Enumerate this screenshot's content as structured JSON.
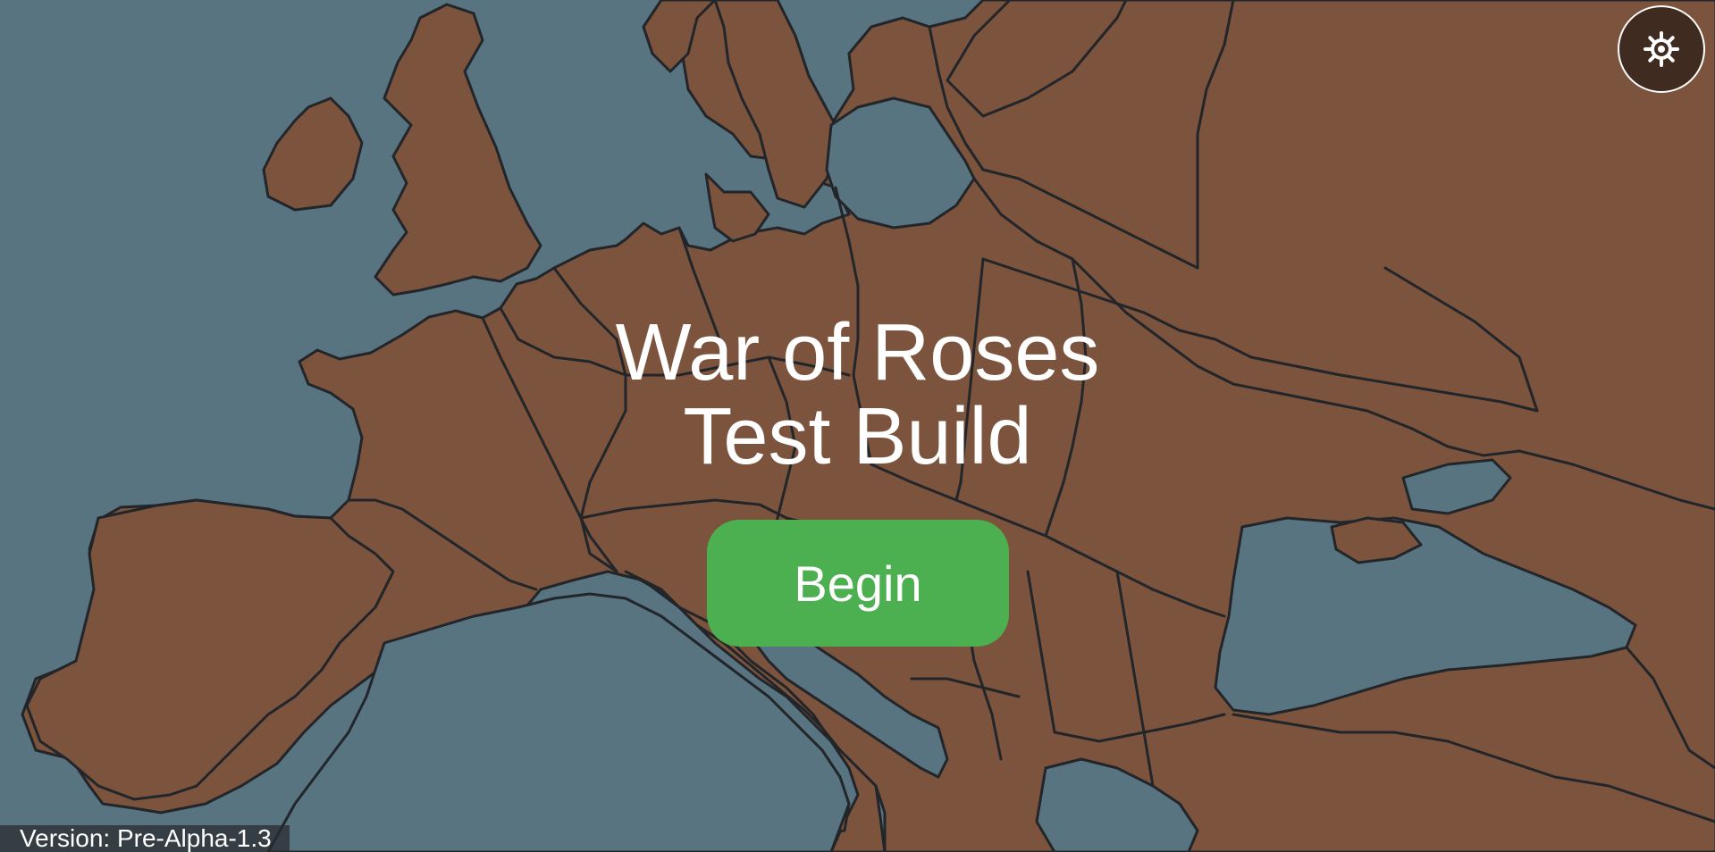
{
  "title": {
    "line1": "War of Roses",
    "line2": "Test Build"
  },
  "begin_button": {
    "label": "Begin"
  },
  "settings_button": {
    "icon": "gear-icon"
  },
  "version": {
    "text": "Version: Pre-Alpha-1.3"
  },
  "colors": {
    "sea": "#587480",
    "land": "#7c533c",
    "border": "#22262a",
    "button": "#4caf50",
    "settings_bg": "#3f2b1f",
    "text": "#ffffff"
  }
}
